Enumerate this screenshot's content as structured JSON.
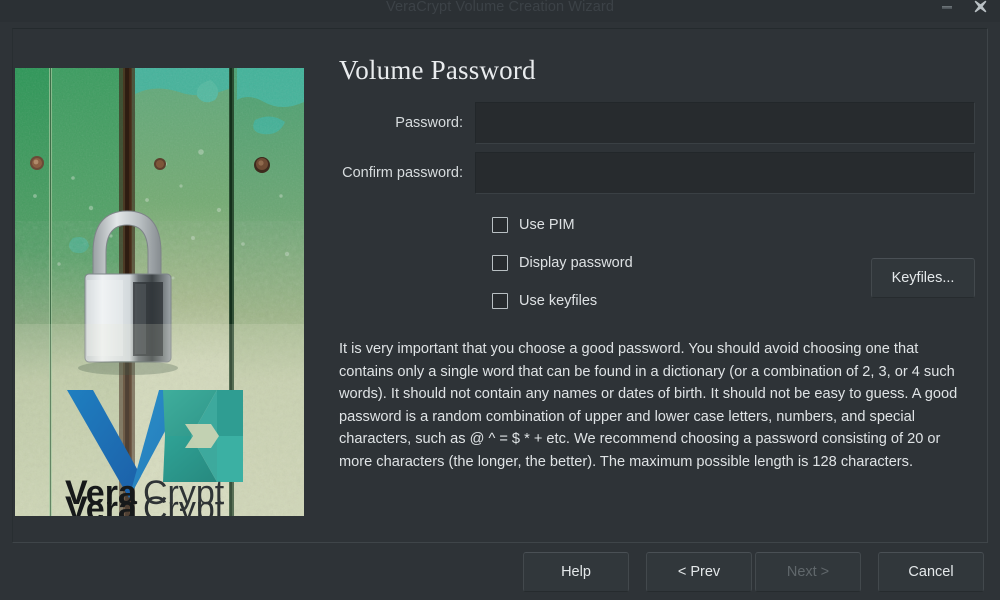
{
  "window": {
    "title": "VeraCrypt Volume Creation Wizard",
    "controls": {
      "minimize_icon": "minimize-icon",
      "close_icon": "close-icon"
    }
  },
  "page": {
    "title": "Volume Password"
  },
  "banner": {
    "image_name": "green-door-padlock-photo",
    "logo_text_primary": "Vera",
    "logo_text_secondary": "Crypt",
    "logo_icon": "veracrypt-logo-icon",
    "colors": {
      "door_green_dark": "#2f9a58",
      "door_green_mid": "#6f9a6a",
      "door_pale": "#cdd6b4",
      "accent_cyan": "#2bb3b0",
      "logo_blue": "#1f6fb5",
      "logo_teal": "#2ea39a",
      "padlock_silver": "#d8dde0"
    }
  },
  "form": {
    "password": {
      "label": "Password:",
      "value": "",
      "placeholder": ""
    },
    "confirm_password": {
      "label": "Confirm password:",
      "value": "",
      "placeholder": ""
    }
  },
  "checkboxes": [
    {
      "label": "Use PIM",
      "checked": false,
      "name": "use-pim"
    },
    {
      "label": "Display password",
      "checked": false,
      "name": "display-password"
    },
    {
      "label": "Use keyfiles",
      "checked": false,
      "name": "use-keyfiles"
    }
  ],
  "keyfiles_button": {
    "label": "Keyfiles..."
  },
  "description": "It is very important that you choose a good password. You should avoid choosing one that contains only a single word that can be found in a dictionary (or a combination of 2, 3, or 4 such words). It should not contain any names or dates of birth. It should not be easy to guess. A good password is a random combination of upper and lower case letters, numbers, and special characters, such as @ ^ = $ * + etc. We recommend choosing a password consisting of 20 or more characters (the longer, the better). The maximum possible length is 128 characters.",
  "footer": {
    "help": {
      "label": "Help",
      "disabled": false
    },
    "prev": {
      "label": "< Prev",
      "disabled": false
    },
    "next": {
      "label": "Next >",
      "disabled": true
    },
    "cancel": {
      "label": "Cancel",
      "disabled": false
    }
  },
  "colors": {
    "window_bg": "#2e3337",
    "titlebar_bg": "#2b3034",
    "input_bg": "#272b2e",
    "text_primary": "#e4e8ea",
    "text_disabled": "#60676b",
    "button_bg": "#31373b"
  }
}
